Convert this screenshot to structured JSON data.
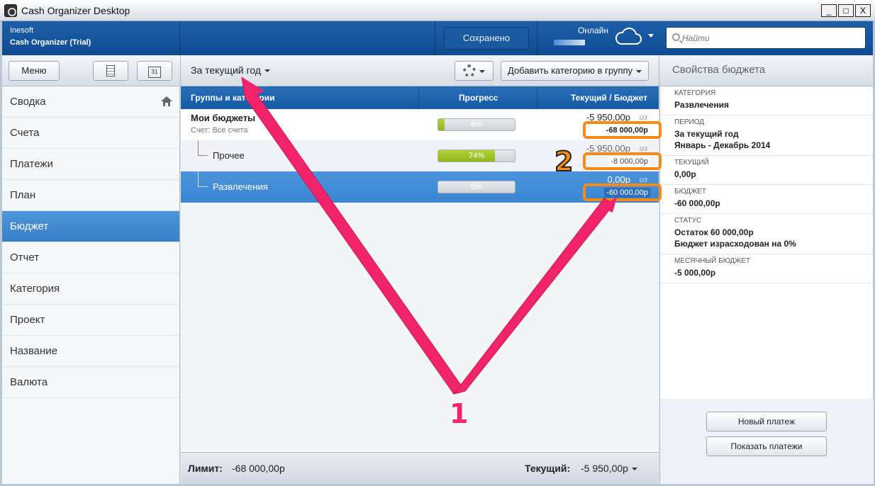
{
  "window": {
    "title": "Cash Organizer Desktop",
    "min": "_",
    "max": "□",
    "close": "X"
  },
  "header": {
    "company": "Inesoft",
    "product": "Cash Organizer (Trial)",
    "saved": "Сохранено",
    "online": "Онлайн",
    "search_placeholder": "Найти"
  },
  "toolbar": {
    "menu": "Меню",
    "period": "За текущий год",
    "add_category": "Добавить категорию в группу",
    "props_title": "Свойства бюджета"
  },
  "sidebar": {
    "items": [
      {
        "label": "Сводка"
      },
      {
        "label": "Счета"
      },
      {
        "label": "Платежи"
      },
      {
        "label": "План"
      },
      {
        "label": "Бюджет"
      },
      {
        "label": "Отчет"
      },
      {
        "label": "Категория"
      },
      {
        "label": "Проект"
      },
      {
        "label": "Название"
      },
      {
        "label": "Валюта"
      }
    ],
    "active_index": 4
  },
  "table": {
    "headers": {
      "groups": "Группы и категории",
      "progress": "Прогресс",
      "current_budget": "Текущий / Бюджет"
    },
    "rows": [
      {
        "name": "Мои бюджеты",
        "sub": "Счет: Все счета",
        "progress_pct": 8,
        "progress_label": "8%",
        "current": "-5 950,00р",
        "iz": "из",
        "budget": "-68 000,00р"
      },
      {
        "name": "Прочее",
        "progress_pct": 74,
        "progress_label": "74%",
        "current": "-5 950,00р",
        "iz": "из",
        "budget": "-8 000,00р"
      },
      {
        "name": "Развлечения",
        "progress_pct": 0,
        "progress_label": "0%",
        "current": "0,00р",
        "iz": "из",
        "budget": "-60 000,00р"
      }
    ]
  },
  "footer": {
    "limit_label": "Лимит:",
    "limit_value": "-68 000,00р",
    "current_label": "Текущий:",
    "current_value": "-5 950,00р"
  },
  "properties": {
    "category_label": "Категория",
    "category_value": "Развлечения",
    "period_label": "Период",
    "period_value1": "За текущий год",
    "period_value2": "Январь - Декабрь 2014",
    "current_label": "Текущий",
    "current_value": "0,00р",
    "budget_label": "Бюджет",
    "budget_value": "-60 000,00р",
    "status_label": "Статус",
    "status_value1": "Остаток 60 000,00р",
    "status_value2": "Бюджет израсходован на 0%",
    "monthly_label": "Месячный бюджет",
    "monthly_value": "-5 000,00р"
  },
  "buttons": {
    "new_payment": "Новый платеж",
    "show_payments": "Показать платежи"
  },
  "annotations": {
    "label1": "1",
    "label2": "2"
  },
  "colors": {
    "accent": "#1d5fa8",
    "highlight": "#f58a18",
    "arrow": "#f2256c"
  }
}
